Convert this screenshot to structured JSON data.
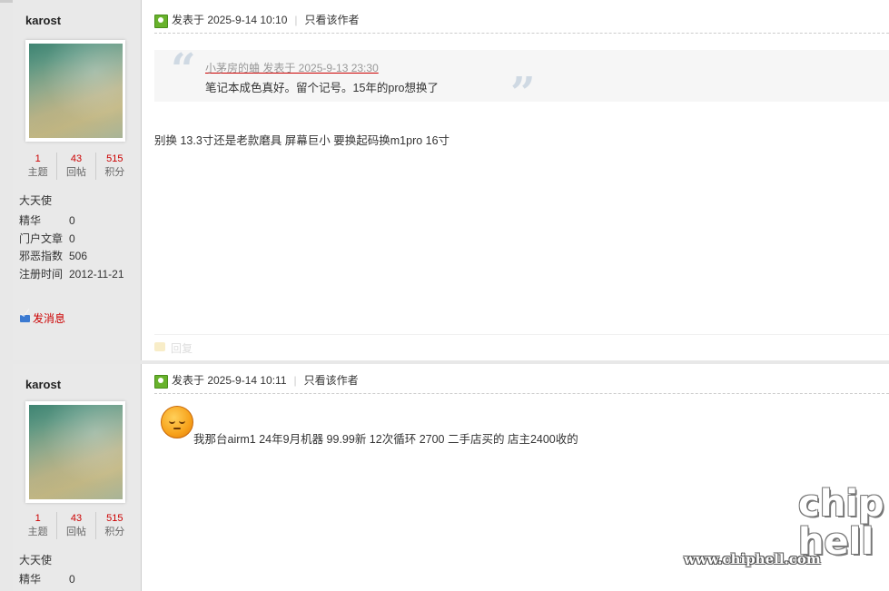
{
  "posts": [
    {
      "author": "karost",
      "stats": [
        {
          "num": "1",
          "label": "主题"
        },
        {
          "num": "43",
          "label": "回帖"
        },
        {
          "num": "515",
          "label": "积分"
        }
      ],
      "rank": "大天使",
      "info": [
        {
          "k": "精华",
          "v": "0"
        },
        {
          "k": "门户文章",
          "v": "0"
        },
        {
          "k": "邪恶指数",
          "v": "506"
        },
        {
          "k": "注册时间",
          "v": "2012-11-21"
        }
      ],
      "send_msg": "发消息",
      "posted": "发表于 2025-9-14 10:10",
      "only_author": "只看该作者",
      "quote": {
        "author_line": "小茅房的蛐 发表于 2025-9-13 23:30",
        "text": "笔记本成色真好。留个记号。15年的pro想换了"
      },
      "body": "别换 13.3寸还是老款磨具 屏幕巨小 要换起码换m1pro 16寸",
      "reply": "回复"
    },
    {
      "author": "karost",
      "stats": [
        {
          "num": "1",
          "label": "主题"
        },
        {
          "num": "43",
          "label": "回帖"
        },
        {
          "num": "515",
          "label": "积分"
        }
      ],
      "rank": "大天使",
      "info": [
        {
          "k": "精华",
          "v": "0"
        }
      ],
      "posted": "发表于 2025-9-14 10:11",
      "only_author": "只看该作者",
      "body": "我那台airm1  24年9月机器 99.99新 12次循环 2700 二手店买的 店主2400收的"
    }
  ],
  "watermark": {
    "site": "www.chiphell.com",
    "logo": "chip\nhell"
  }
}
